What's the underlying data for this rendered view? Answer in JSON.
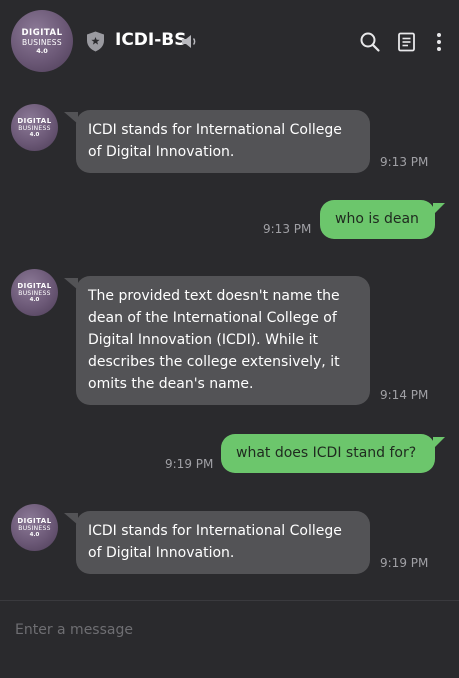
{
  "header": {
    "avatar": {
      "line1": "DIGITAL",
      "line2": "BUSINESS",
      "line3": "4.0"
    },
    "title": "ICDI-BS",
    "icons": [
      "shield-icon",
      "speaker-icon",
      "search-icon",
      "notes-icon",
      "more-vertical-icon"
    ]
  },
  "messages": [
    {
      "side": "incoming",
      "text": "ICDI stands for International College of Digital Innovation.",
      "time": "9:13 PM"
    },
    {
      "side": "outgoing",
      "text": "who is dean",
      "time": "9:13 PM"
    },
    {
      "side": "incoming",
      "text": "The provided text doesn't name the dean of the International College of Digital Innovation (ICDI).  While it describes the college extensively,  it omits the dean's name.",
      "time": "9:14 PM"
    },
    {
      "side": "outgoing",
      "text": "what does ICDI stand for?",
      "time": "9:19 PM"
    },
    {
      "side": "incoming",
      "text": "ICDI stands for International College of Digital Innovation.",
      "time": "9:19 PM"
    }
  ],
  "composer": {
    "placeholder": "Enter a message",
    "value": ""
  },
  "colors": {
    "background": "#2a2a2d",
    "incoming_bubble": "#535356",
    "outgoing_bubble": "#6cc66c"
  }
}
